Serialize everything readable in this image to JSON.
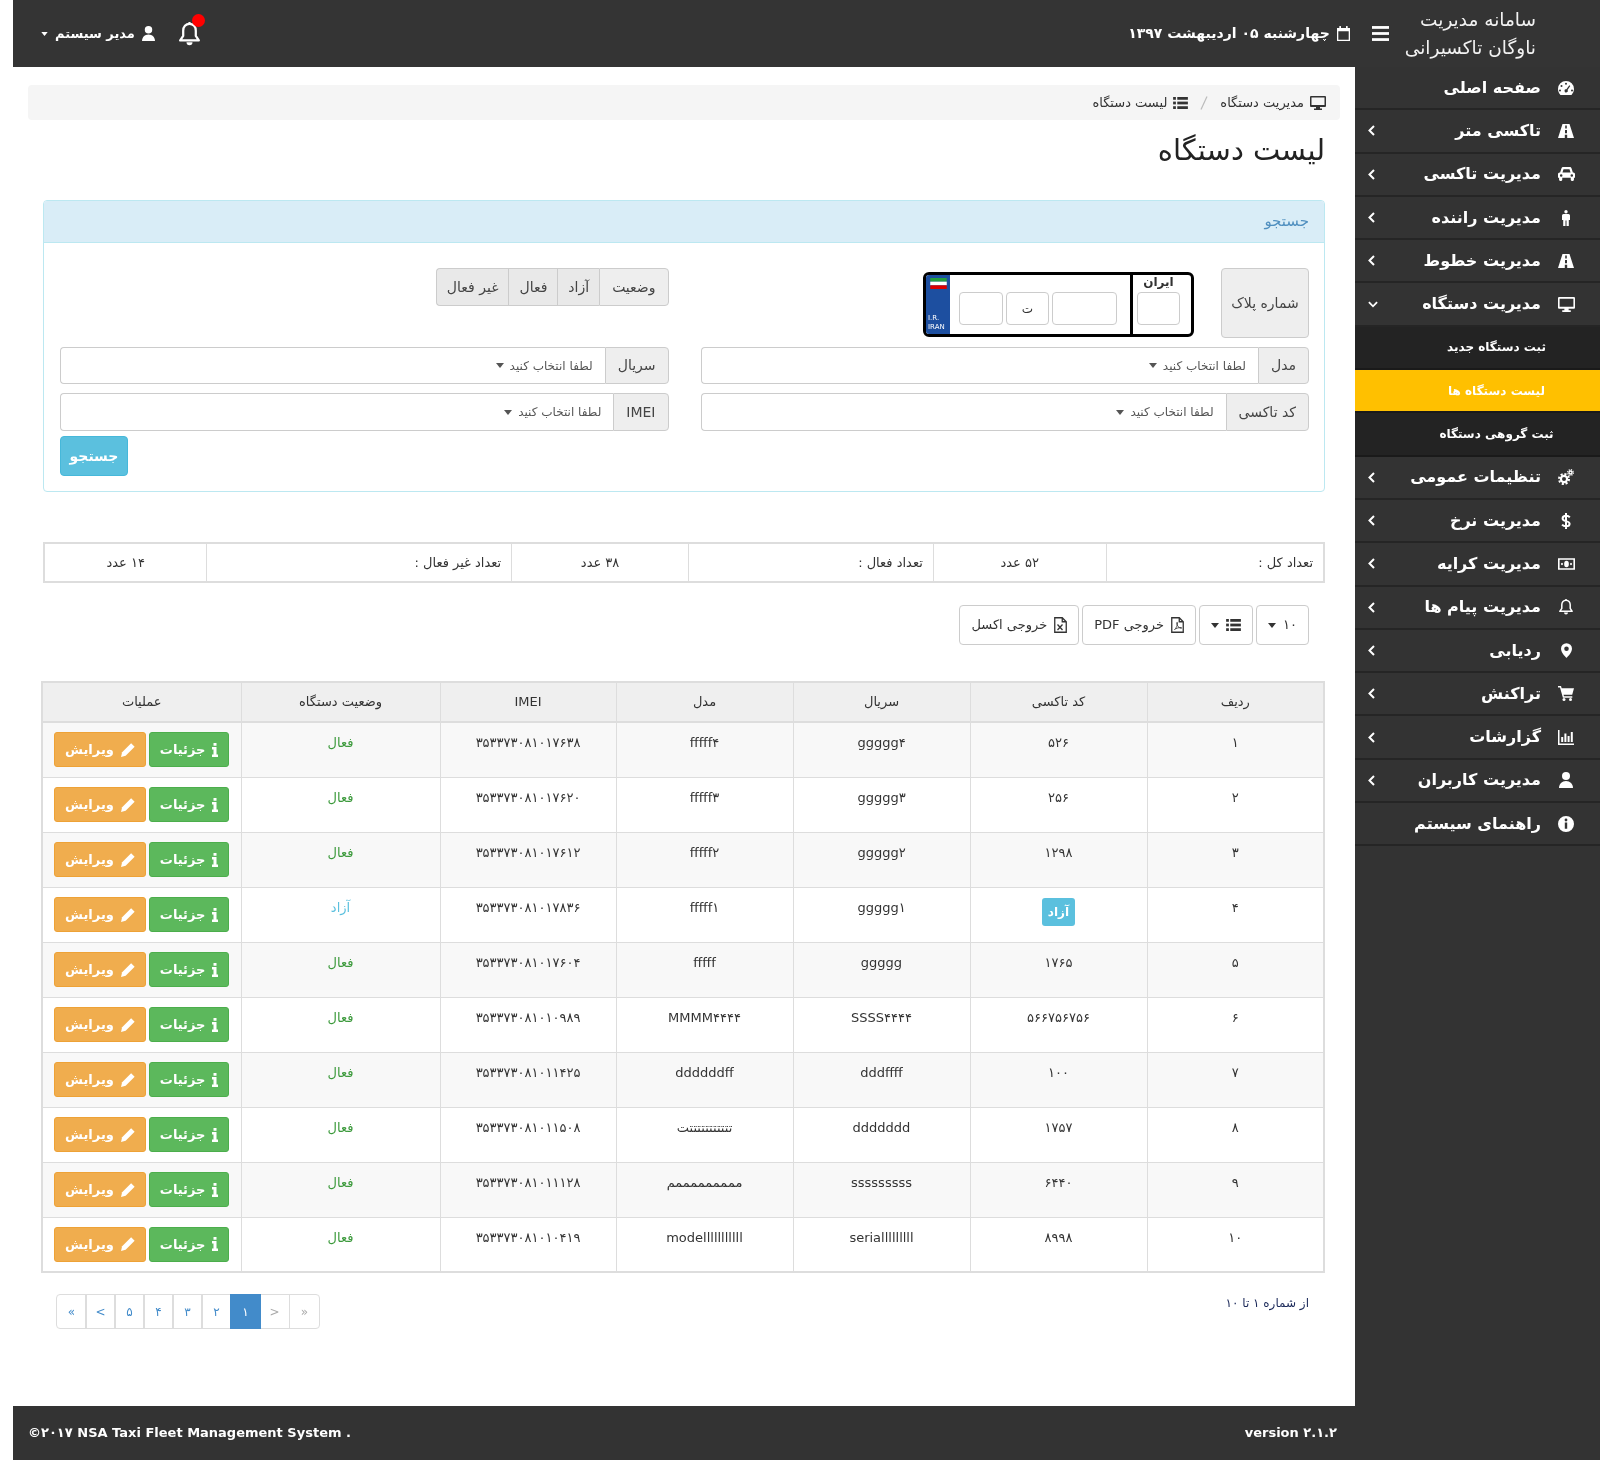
{
  "topbar": {
    "title_lines": [
      "سامانه مدیریت",
      "ناوگان تاکسیرانی"
    ],
    "date": "چهارشنبه ۰۵ اردیبهشت ۱۳۹۷",
    "notification_dot": true,
    "user": "مدیر سیستم"
  },
  "sidebar": {
    "items": [
      {
        "label": "صفحه اصلی",
        "kind": "link"
      },
      {
        "label": "تاکسی متر",
        "kind": "menu",
        "expanded": false
      },
      {
        "label": "مدیریت تاکسی",
        "kind": "menu",
        "expanded": false
      },
      {
        "label": "مدیریت راننده",
        "kind": "menu",
        "expanded": false
      },
      {
        "label": "مدیریت خطوط",
        "kind": "menu",
        "expanded": false
      },
      {
        "label": "مدیریت دستگاه",
        "kind": "menu",
        "expanded": true,
        "children": [
          {
            "label": "ثبت دستگاه جدید",
            "selected": false
          },
          {
            "label": "لیست دستگاه ها",
            "selected": true
          },
          {
            "label": "ثبت گروهی دستگاه",
            "selected": false
          }
        ]
      },
      {
        "label": "تنظیمات عمومی",
        "kind": "menu",
        "expanded": false
      },
      {
        "label": "مدیریت نرخ",
        "kind": "menu",
        "expanded": false
      },
      {
        "label": "مدیریت کرایه",
        "kind": "menu",
        "expanded": false
      },
      {
        "label": "مدیریت پیام ها",
        "kind": "menu",
        "expanded": false
      },
      {
        "label": "ردیابی",
        "kind": "menu",
        "expanded": false
      },
      {
        "label": "تراکنش",
        "kind": "menu",
        "expanded": false
      },
      {
        "label": "گزارشات",
        "kind": "menu",
        "expanded": false
      },
      {
        "label": "مدیریت کاربران",
        "kind": "menu",
        "expanded": false
      },
      {
        "label": "راهنمای سیستم",
        "kind": "link"
      }
    ]
  },
  "breadcrumb": [
    {
      "label": "مدیریت دستگاه"
    },
    {
      "label": "لیست دستگاه"
    }
  ],
  "page_title": "لیست دستگاه",
  "search_panel": {
    "title": "جستجو",
    "plate": {
      "label": "شماره پلاک",
      "country_code_lines": [
        "I.R.",
        "IRAN"
      ],
      "letter": "ت",
      "region_title": "ایران"
    },
    "status": {
      "label": "وضعیت",
      "options": [
        {
          "label": "آزاد",
          "selected": false
        },
        {
          "label": "فعال",
          "selected": false
        },
        {
          "label": "غیر فعال",
          "selected": false
        }
      ]
    },
    "fields": [
      {
        "label": "مدل",
        "placeholder": "لطفا انتخاب کنید"
      },
      {
        "label": "سریال",
        "placeholder": "لطفا انتخاب کنید"
      },
      {
        "label": "کد تاکسی",
        "placeholder": "لطفا انتخاب کنید"
      },
      {
        "label": "IMEI",
        "placeholder": "لطفا انتخاب کنید"
      }
    ],
    "button": "جستجو"
  },
  "stats": [
    {
      "label": "تعداد کل :",
      "value": "۵۲ عدد"
    },
    {
      "label": "تعداد فعال :",
      "value": "۳۸ عدد"
    },
    {
      "label": "تعداد غیر فعال :",
      "value": "۱۴ عدد"
    }
  ],
  "toolbar": {
    "page_size": "۱۰",
    "export_buttons": [
      {
        "kind": "pdf",
        "label": "خروجی PDF"
      },
      {
        "kind": "excel",
        "label": "خروجی اکسل"
      }
    ]
  },
  "table": {
    "columns": [
      "ردیف",
      "کد تاکسی",
      "سریال",
      "مدل",
      "IMEI",
      "وضعیت دستگاه",
      "عملیات"
    ],
    "rows": [
      {
        "row": "۱",
        "taxi_code": {
          "kind": "text",
          "text": "۵۲۶"
        },
        "serial": "ggggg۴",
        "model": "fffff۴",
        "imei": "۳۵۳۳۷۳۰۸۱۰۱۷۶۳۸",
        "status": {
          "text": "فعال",
          "color": "#3c9a3c"
        },
        "actions": [
          {
            "kind": "details",
            "label": "جزئیات"
          },
          {
            "kind": "edit",
            "label": "ویرایش"
          }
        ]
      },
      {
        "row": "۲",
        "taxi_code": {
          "kind": "text",
          "text": "۲۵۶"
        },
        "serial": "ggggg۳",
        "model": "fffff۳",
        "imei": "۳۵۳۳۷۳۰۸۱۰۱۷۶۲۰",
        "status": {
          "text": "فعال",
          "color": "#3c9a3c"
        },
        "actions": [
          {
            "kind": "details",
            "label": "جزئیات"
          },
          {
            "kind": "edit",
            "label": "ویرایش"
          }
        ]
      },
      {
        "row": "۳",
        "taxi_code": {
          "kind": "text",
          "text": "۱۲۹۸"
        },
        "serial": "ggggg۲",
        "model": "fffff۲",
        "imei": "۳۵۳۳۷۳۰۸۱۰۱۷۶۱۲",
        "status": {
          "text": "فعال",
          "color": "#3c9a3c"
        },
        "actions": [
          {
            "kind": "details",
            "label": "جزئیات"
          },
          {
            "kind": "edit",
            "label": "ویرایش"
          }
        ]
      },
      {
        "row": "۴",
        "taxi_code": {
          "kind": "badge",
          "text": "آزاد"
        },
        "serial": "ggggg۱",
        "model": "fffff۱",
        "imei": "۳۵۳۳۷۳۰۸۱۰۱۷۸۳۶",
        "status": {
          "text": "آزاد",
          "color": "#5bc0de"
        },
        "actions": [
          {
            "kind": "details",
            "label": "جزئیات"
          },
          {
            "kind": "edit",
            "label": "ویرایش"
          }
        ]
      },
      {
        "row": "۵",
        "taxi_code": {
          "kind": "text",
          "text": "۱۷۶۵"
        },
        "serial": "ggggg",
        "model": "fffff",
        "imei": "۳۵۳۳۷۳۰۸۱۰۱۷۶۰۴",
        "status": {
          "text": "فعال",
          "color": "#3c9a3c"
        },
        "actions": [
          {
            "kind": "details",
            "label": "جزئیات"
          },
          {
            "kind": "edit",
            "label": "ویرایش"
          }
        ]
      },
      {
        "row": "۶",
        "taxi_code": {
          "kind": "text",
          "text": "۵۶۶۷۵۶۷۵۶"
        },
        "serial": "SSSS۴۴۴۴",
        "model": "MMMM۴۴۴۴",
        "imei": "۳۵۳۳۷۳۰۸۱۰۱۰۹۸۹",
        "status": {
          "text": "فعال",
          "color": "#3c9a3c"
        },
        "actions": [
          {
            "kind": "details",
            "label": "جزئیات"
          },
          {
            "kind": "edit",
            "label": "ویرایش"
          }
        ]
      },
      {
        "row": "۷",
        "taxi_code": {
          "kind": "text",
          "text": "۱۰۰"
        },
        "serial": "dddffff",
        "model": "ddddddff",
        "imei": "۳۵۳۳۷۳۰۸۱۰۱۱۴۲۵",
        "status": {
          "text": "فعال",
          "color": "#3c9a3c"
        },
        "actions": [
          {
            "kind": "details",
            "label": "جزئیات"
          },
          {
            "kind": "edit",
            "label": "ویرایش"
          }
        ]
      },
      {
        "row": "۸",
        "taxi_code": {
          "kind": "text",
          "text": "۱۷۵۷"
        },
        "serial": "ddddddd",
        "model": "تتتتتتتتتتتت",
        "imei": "۳۵۳۳۷۳۰۸۱۰۱۱۵۰۸",
        "status": {
          "text": "فعال",
          "color": "#3c9a3c"
        },
        "actions": [
          {
            "kind": "details",
            "label": "جزئیات"
          },
          {
            "kind": "edit",
            "label": "ویرایش"
          }
        ]
      },
      {
        "row": "۹",
        "taxi_code": {
          "kind": "text",
          "text": "۶۴۴۰"
        },
        "serial": "sssssssss",
        "model": "مممممممممم",
        "imei": "۳۵۳۳۷۳۰۸۱۰۱۱۱۲۸",
        "status": {
          "text": "فعال",
          "color": "#3c9a3c"
        },
        "actions": [
          {
            "kind": "details",
            "label": "جزئیات"
          },
          {
            "kind": "edit",
            "label": "ویرایش"
          }
        ]
      },
      {
        "row": "۱۰",
        "taxi_code": {
          "kind": "text",
          "text": "۸۹۹۸"
        },
        "serial": "serialllllllll",
        "model": "modelllllllllll",
        "imei": "۳۵۳۳۷۳۰۸۱۰۱۰۴۱۹",
        "status": {
          "text": "فعال",
          "color": "#3c9a3c"
        },
        "actions": [
          {
            "kind": "details",
            "label": "جزئیات"
          },
          {
            "kind": "edit",
            "label": "ویرایش"
          }
        ]
      }
    ]
  },
  "pagination": {
    "info": "از شماره ۱ تا ۱۰",
    "pages": [
      {
        "label": "»",
        "selected": false,
        "disabled": true
      },
      {
        "label": ">",
        "selected": false,
        "disabled": true
      },
      {
        "label": "۱",
        "selected": true,
        "disabled": false
      },
      {
        "label": "۲",
        "selected": false,
        "disabled": false
      },
      {
        "label": "۳",
        "selected": false,
        "disabled": false
      },
      {
        "label": "۴",
        "selected": false,
        "disabled": false
      },
      {
        "label": "۵",
        "selected": false,
        "disabled": false
      },
      {
        "label": "<",
        "selected": false,
        "disabled": false
      },
      {
        "label": "«",
        "selected": false,
        "disabled": false
      }
    ]
  },
  "footer": {
    "copyright": "©۲۰۱۷ NSA Taxi Fleet Management System .",
    "version": "version ۲.۱.۲"
  }
}
